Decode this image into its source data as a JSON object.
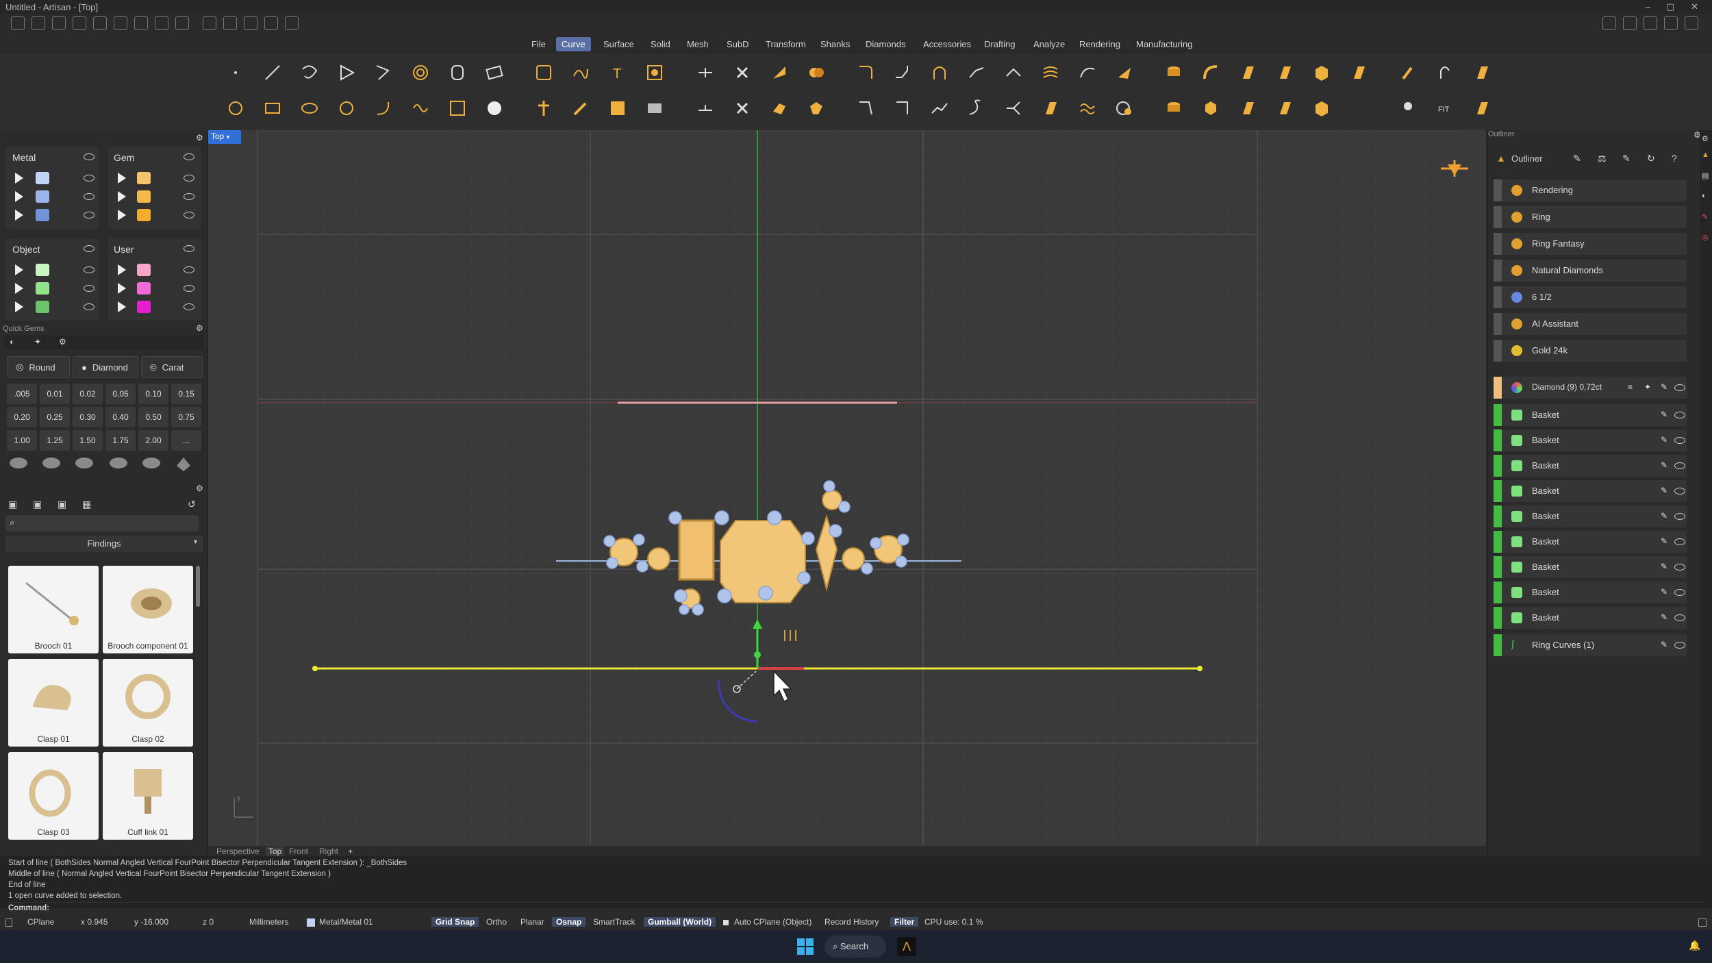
{
  "window": {
    "title": "Untitled - Artisan - [Top]"
  },
  "menu": [
    "File",
    "Curve",
    "Surface",
    "Solid",
    "Mesh",
    "SubD",
    "Transform",
    "Shanks",
    "Diamonds",
    "Accessories",
    "Drafting",
    "Analyze",
    "Rendering",
    "Manufacturing"
  ],
  "menu_active": "Curve",
  "layers": {
    "metal_label": "Metal",
    "gem_label": "Gem",
    "object_label": "Object",
    "user_label": "User",
    "metal_colors": [
      "#c3d3f5",
      "#9ab6e8",
      "#7194d6"
    ],
    "gem_colors": [
      "#f6c36a",
      "#f5b94a",
      "#f3ad2c"
    ],
    "object_colors": [
      "#c9f5c3",
      "#93e38c",
      "#6cc36a"
    ],
    "user_colors": [
      "#f7a6c8",
      "#f06bd8",
      "#e61ed0"
    ]
  },
  "quick_gems": {
    "title": "Quick Gems",
    "shape": "Round",
    "material": "Diamond",
    "unit": "Carat",
    "sizes": [
      ".005",
      "0.01",
      "0.02",
      "0.05",
      "0.10",
      "0.15",
      "0.20",
      "0.25",
      "0.30",
      "0.40",
      "0.50",
      "0.75",
      "1.00",
      "1.25",
      "1.50",
      "1.75",
      "2.00",
      "..."
    ]
  },
  "library": {
    "category": "Findings",
    "items": [
      {
        "label": "Brooch 01"
      },
      {
        "label": "Brooch component 01"
      },
      {
        "label": "Clasp 01"
      },
      {
        "label": "Clasp 02"
      },
      {
        "label": "Clasp 03"
      },
      {
        "label": "Cuff link 01"
      }
    ]
  },
  "viewport": {
    "name": "Top",
    "tabs": [
      "Perspective",
      "Top",
      "Front",
      "Right",
      "+"
    ]
  },
  "outliner": {
    "title": "Outliner",
    "top_items": [
      {
        "label": "Rendering",
        "color": "#e0a030"
      },
      {
        "label": "Ring",
        "color": "#e0a030"
      },
      {
        "label": "Ring Fantasy",
        "color": "#e0a030"
      },
      {
        "label": "Natural Diamonds",
        "color": "#e0a030"
      },
      {
        "label": "6 1/2",
        "color": "#6688dd"
      },
      {
        "label": "AI Assistant",
        "color": "#e0a030"
      },
      {
        "label": "Gold 24k",
        "color": "#e0c030"
      }
    ],
    "diamond_group": "Diamond (9) 0,72ct",
    "baskets": [
      "Basket",
      "Basket",
      "Basket",
      "Basket",
      "Basket",
      "Basket",
      "Basket",
      "Basket",
      "Basket"
    ],
    "curves": "Ring Curves (1)"
  },
  "command": {
    "lines": [
      "Start of line ( BothSides  Normal  Angled  Vertical  FourPoint  Bisector  Perpendicular  Tangent  Extension ): _BothSides",
      "Middle of line ( Normal  Angled  Vertical  FourPoint  Bisector  Perpendicular  Tangent  Extension )",
      "End of line",
      "1 open curve added to selection."
    ],
    "prompt": "Command:"
  },
  "status": {
    "cplane": "CPlane",
    "x": "x 0.945",
    "y": "y -16.000",
    "z": "z 0",
    "units": "Millimeters",
    "layer": "Metal/Metal 01",
    "grid_snap": "Grid Snap",
    "ortho": "Ortho",
    "planar": "Planar",
    "osnap": "Osnap",
    "smarttrack": "SmartTrack",
    "gumball": "Gumball (World)",
    "autocplane": "Auto CPlane (Object)",
    "record_history": "Record History",
    "filter": "Filter",
    "cpu": "CPU use: 0.1 %"
  },
  "taskbar": {
    "search": "Search"
  }
}
